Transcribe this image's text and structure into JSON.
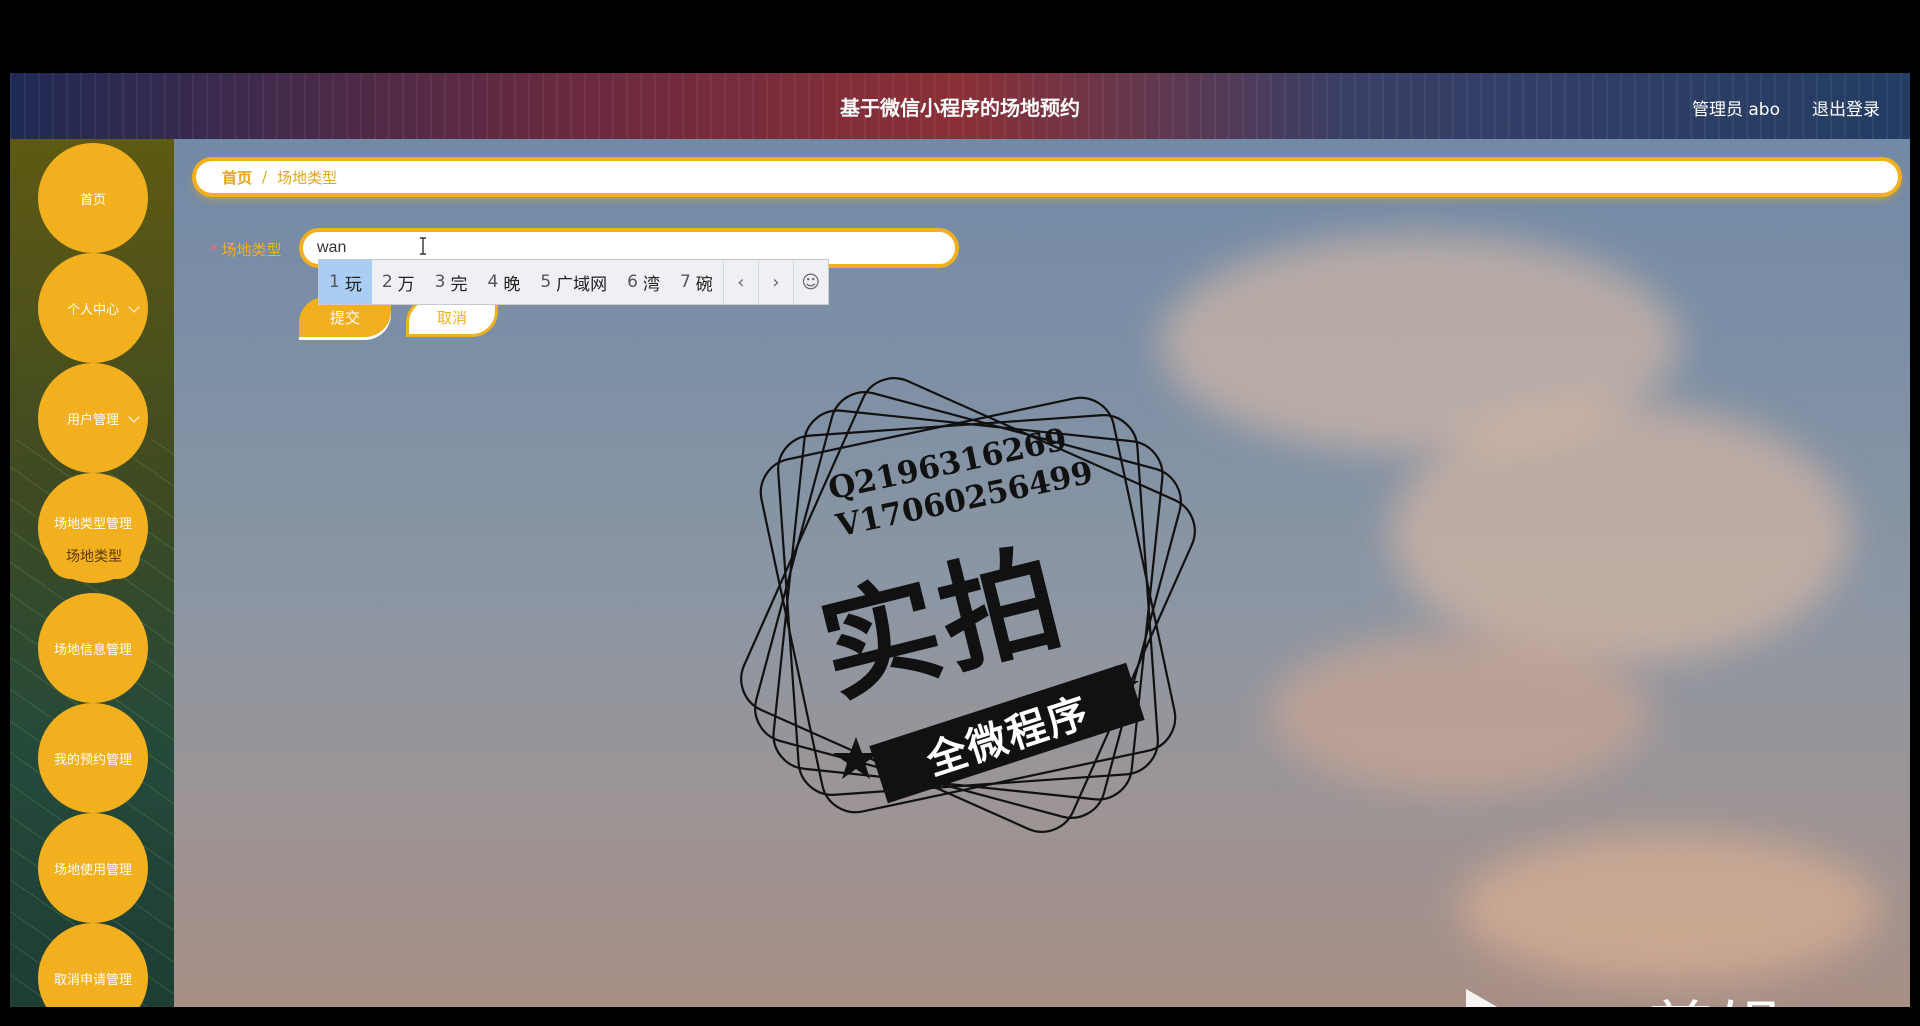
{
  "header": {
    "title": "基于微信小程序的场地预约",
    "user": "管理员 abo",
    "logout": "退出登录"
  },
  "sidebar": {
    "items": [
      {
        "label": "首页",
        "has_arrow": false
      },
      {
        "label": "个人中心",
        "has_arrow": true
      },
      {
        "label": "用户管理",
        "has_arrow": true
      },
      {
        "label": "场地类型管理",
        "has_arrow": false
      },
      {
        "label": "场地信息管理",
        "has_arrow": false
      },
      {
        "label": "我的预约管理",
        "has_arrow": false
      },
      {
        "label": "场地使用管理",
        "has_arrow": false
      },
      {
        "label": "取消申请管理",
        "has_arrow": false
      }
    ],
    "sub_item": "场地类型"
  },
  "breadcrumb": {
    "home": "首页",
    "separator": "/",
    "current": "场地类型"
  },
  "form": {
    "label": "场地类型",
    "required_mark": "*",
    "value": "wan",
    "submit": "提交",
    "cancel": "取消"
  },
  "ime": {
    "candidates": [
      {
        "n": "1",
        "t": "玩"
      },
      {
        "n": "2",
        "t": "万"
      },
      {
        "n": "3",
        "t": "完"
      },
      {
        "n": "4",
        "t": "晚"
      },
      {
        "n": "5",
        "t": "广域网"
      },
      {
        "n": "6",
        "t": "湾"
      },
      {
        "n": "7",
        "t": "碗"
      }
    ],
    "prev": "‹",
    "next": "›",
    "emoji": "☺"
  },
  "stamp": {
    "line1": "Q2196316269",
    "line2": "V17060256499",
    "big": "实拍",
    "banner": "全微程序"
  },
  "watermark": {
    "text": "ev剪辑"
  },
  "colors": {
    "accent": "#f2b01e",
    "topbar": "#6b2a3f",
    "sidebar": "#3f4a22"
  }
}
